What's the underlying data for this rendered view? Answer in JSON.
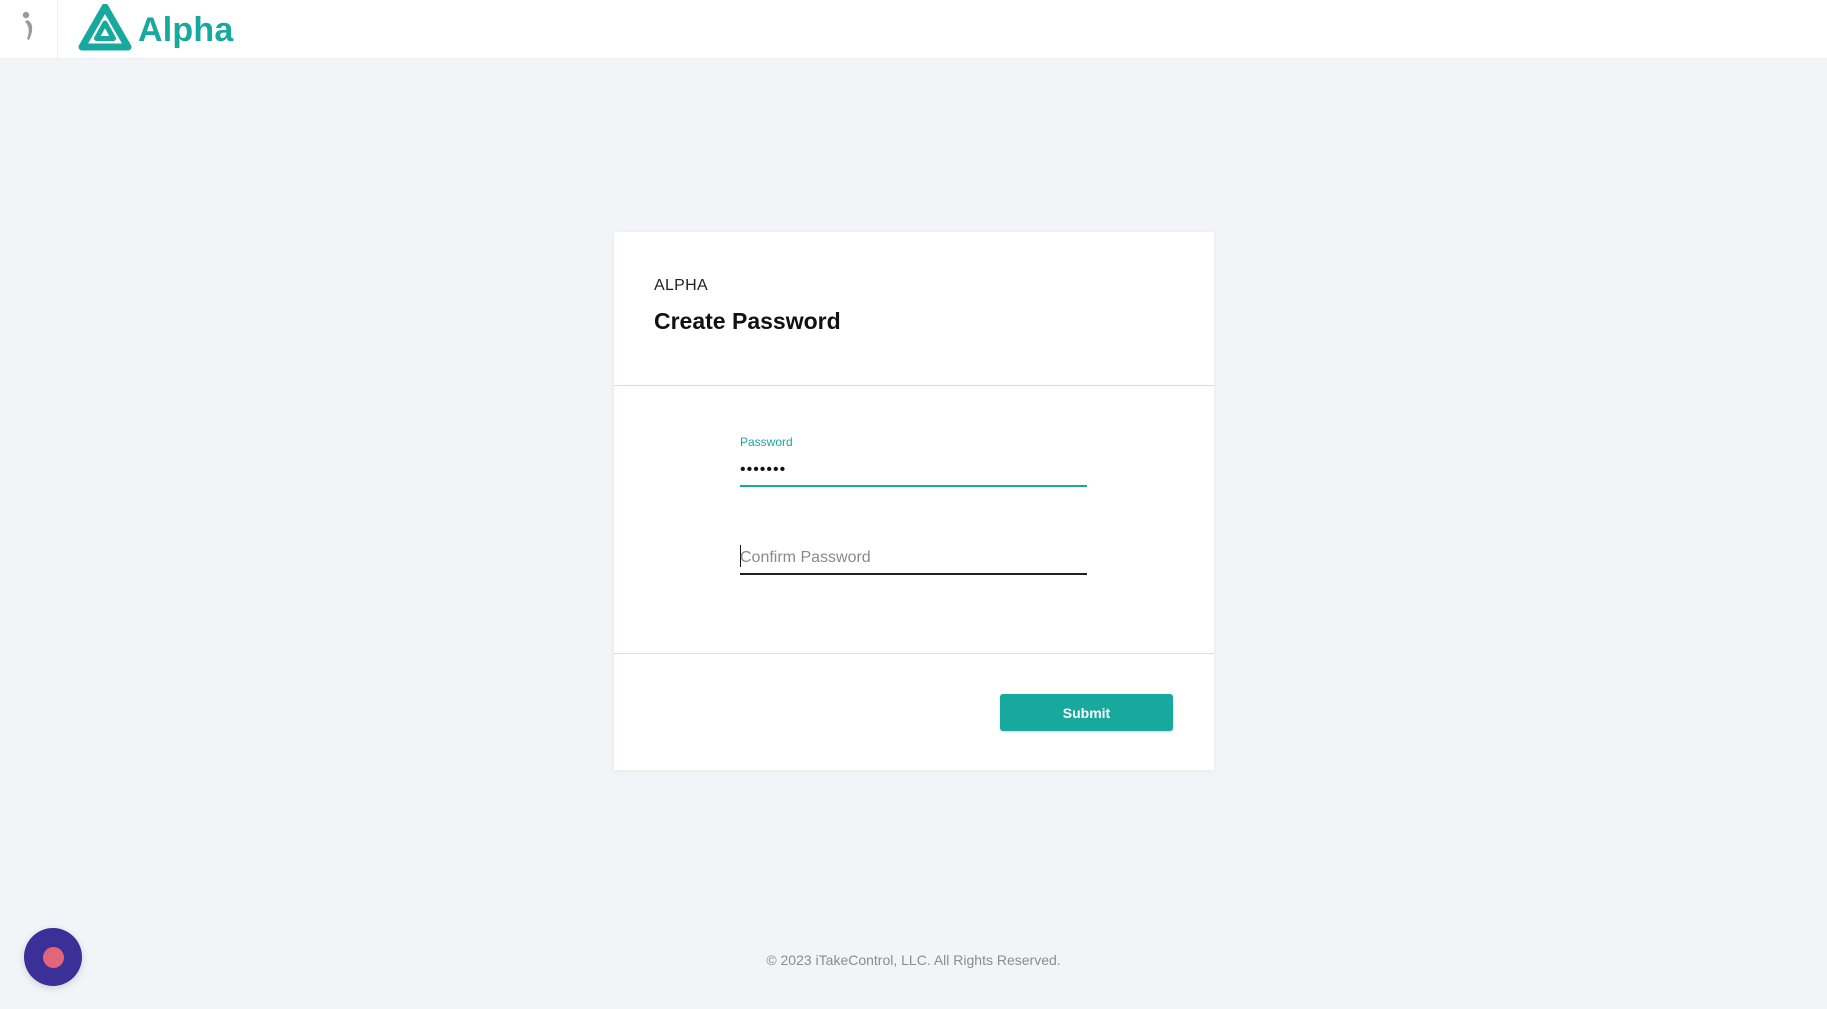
{
  "header": {
    "brand_icon": "figure-icon",
    "logo_icon": "alpha-logo-icon",
    "logo_text": "Alpha"
  },
  "card": {
    "eyebrow": "ALPHA",
    "title": "Create Password",
    "password": {
      "label": "Password",
      "value": "•••••••"
    },
    "confirm_password": {
      "placeholder": "Confirm Password",
      "value": ""
    },
    "submit_label": "Submit"
  },
  "footer": {
    "copyright": "© 2023 iTakeControl, LLC. All Rights Reserved."
  },
  "widget": {
    "icon": "record-icon"
  },
  "colors": {
    "accent": "#17a99e",
    "background": "#f3f4f8",
    "widget": "#3b2f98",
    "widget_dot": "#e2657a"
  }
}
